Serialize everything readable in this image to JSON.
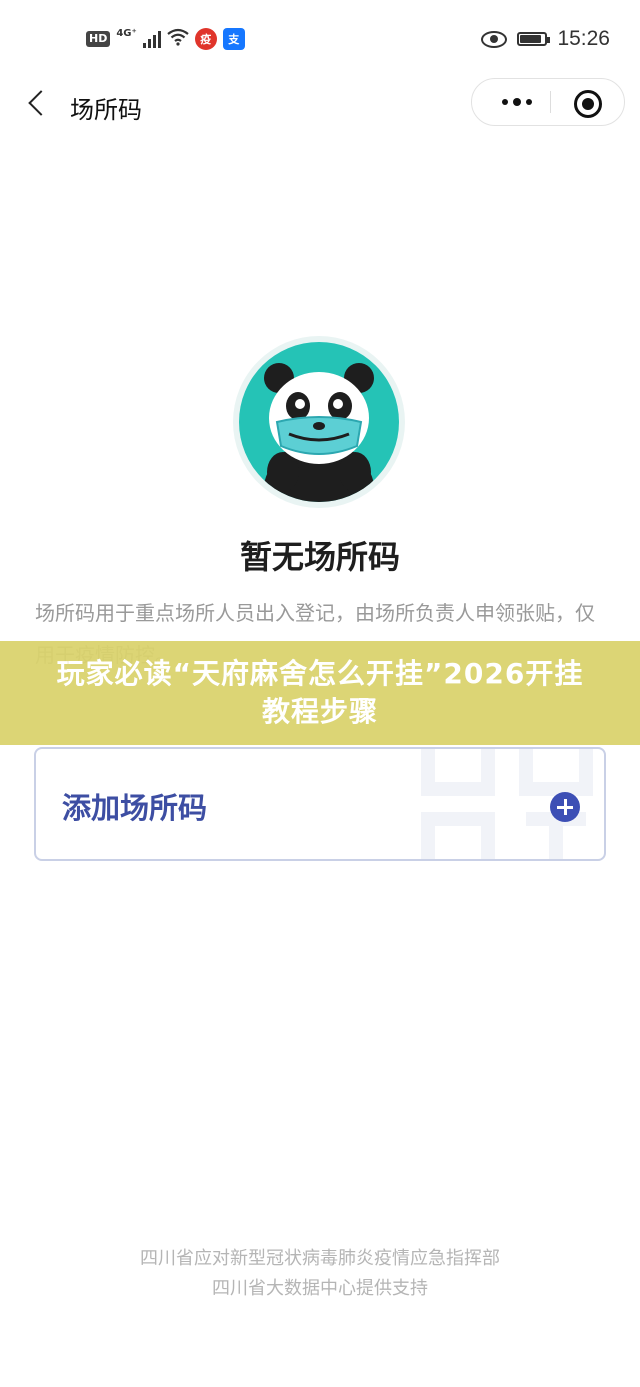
{
  "status_bar": {
    "hd": "HD",
    "network": "4G⁺",
    "app_icon_red": "疫",
    "app_icon_blue": "支",
    "time": "15:26",
    "battery_level": 0.85
  },
  "nav": {
    "title": "场所码"
  },
  "empty_state": {
    "title": "暂无场所码",
    "description": "场所码用于重点场所人员出入登记，由场所负责人申领张贴，仅用于疫情防控。"
  },
  "banner": {
    "text": "玩家必读“天府麻舍怎么开挂”2026开挂教程步骤"
  },
  "add_card": {
    "label": "添加场所码"
  },
  "footer": {
    "line1": "四川省应对新型冠状病毒肺炎疫情应急指挥部",
    "line2": "四川省大数据中心提供支持"
  },
  "colors": {
    "accent": "#3d4ea3",
    "panda_bg": "#25c3b6",
    "banner_bg": "#dad26c"
  }
}
